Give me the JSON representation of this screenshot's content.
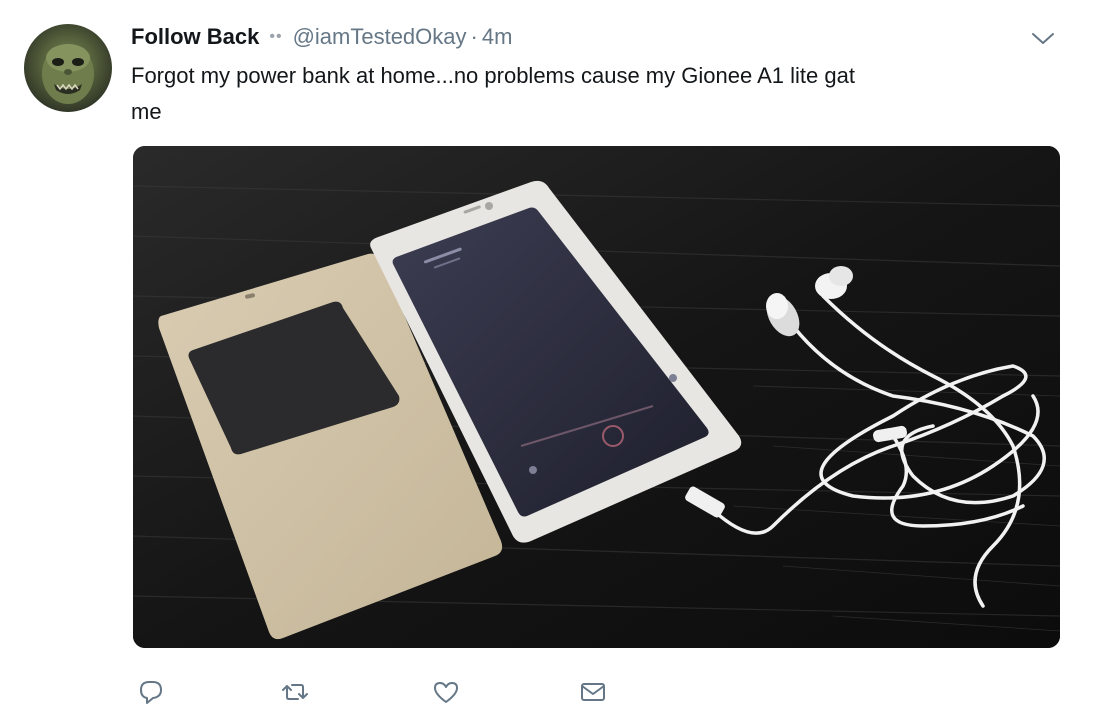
{
  "tweet": {
    "author": {
      "name": "Follow Back",
      "badge": "••",
      "handle": "@iamTestedOkay",
      "separator": "·",
      "time": "4m"
    },
    "text_line1": "Forgot my power bank at home...no problems cause my Gionee A1 lite gat",
    "text_line2": "me",
    "media": {
      "alt_icon": "photo-of-phone-with-earphones"
    },
    "actions": {
      "reply_icon": "reply-icon",
      "retweet_icon": "retweet-icon",
      "like_icon": "heart-icon",
      "dm_icon": "envelope-icon"
    },
    "menu_icon": "chevron-down-icon"
  },
  "colors": {
    "text": "#14171a",
    "secondary": "#657786",
    "icon": "#657786"
  }
}
